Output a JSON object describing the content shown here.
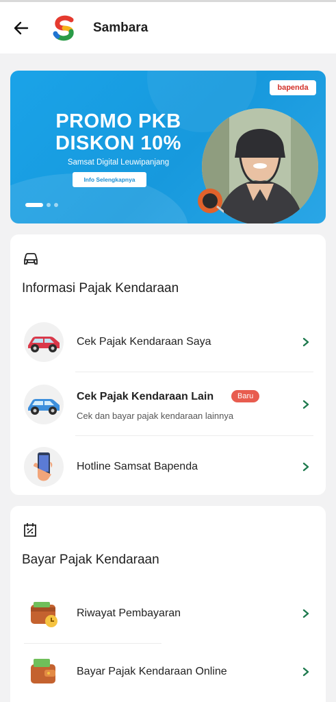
{
  "header": {
    "title": "Sambara",
    "back_icon": "arrow-left-icon",
    "logo_icon": "sambara-logo"
  },
  "banner": {
    "brand": "bapenda",
    "title_line1": "PROMO PKB",
    "title_line2": "DISKON 10%",
    "subtitle": "Samsat Digital Leuwipanjang",
    "button_label": "Info Selengkapnya",
    "slide_count": 3,
    "active_slide": 1,
    "colors": {
      "background": "#1aa3e8",
      "button_text": "#1b8fd3"
    }
  },
  "info_section": {
    "icon": "car-outline-icon",
    "title": "Informasi Pajak Kendaraan",
    "items": [
      {
        "label": "Cek Pajak Kendaraan Saya",
        "icon": "red-car-icon"
      },
      {
        "label": "Cek Pajak Kendaraan Lain",
        "badge": "Baru",
        "sublabel": "Cek dan bayar pajak kendaraan lainnya",
        "icon": "blue-car-icon"
      },
      {
        "label": "Hotline Samsat Bapenda",
        "icon": "phone-hand-icon"
      }
    ]
  },
  "pay_section": {
    "icon": "calendar-tax-icon",
    "title": "Bayar Pajak Kendaraan",
    "items": [
      {
        "label": "Riwayat Pembayaran",
        "icon": "wallet-clock-icon"
      },
      {
        "label": "Bayar Pajak Kendaraan Online",
        "icon": "wallet-money-icon"
      }
    ]
  },
  "colors": {
    "chevron": "#1e7a4e",
    "badge": "#e85c4f"
  }
}
